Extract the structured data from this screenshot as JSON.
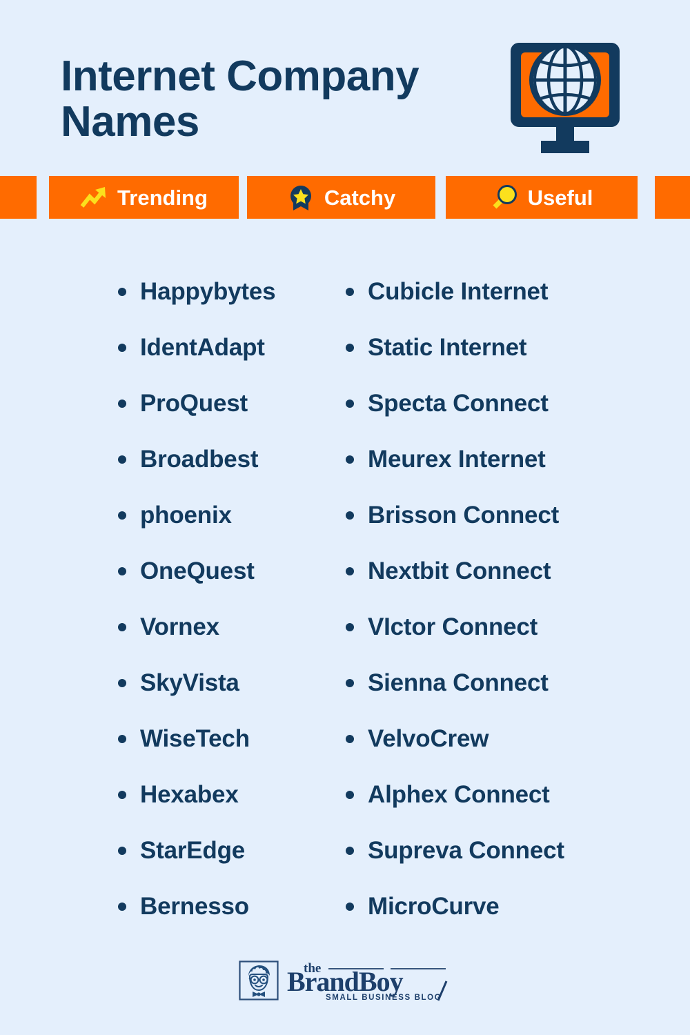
{
  "page": {
    "background_color": "#e4effc",
    "accent_color": "#ff6b00",
    "text_color": "#123a5e",
    "highlight_color": "#fbe01d"
  },
  "header": {
    "title": "Internet Company Names",
    "icon": "monitor-globe-icon"
  },
  "badges": [
    {
      "label": "Trending",
      "icon": "trending-up-icon"
    },
    {
      "label": "Catchy",
      "icon": "award-star-icon"
    },
    {
      "label": "Useful",
      "icon": "magnifier-icon"
    }
  ],
  "lists": {
    "left": [
      "Happybytes",
      "IdentAdapt",
      "ProQuest",
      "Broadbest",
      "phoenix",
      "OneQuest",
      "Vornex",
      "SkyVista",
      "WiseTech",
      "Hexabex",
      "StarEdge",
      "Bernesso"
    ],
    "right": [
      "Cubicle Internet",
      "Static Internet",
      "Specta Connect",
      "Meurex Internet",
      "Brisson Connect",
      "Nextbit Connect",
      "VIctor Connect",
      "Sienna Connect",
      "VelvoCrew",
      "Alphex Connect",
      "Supreva Connect",
      "MicroCurve"
    ]
  },
  "footer": {
    "logo_the": "the",
    "logo_brand": "Brand",
    "logo_boy": "Boy",
    "logo_tagline": "SMALL BUSINESS BLOG",
    "logo_mark": "boy-face-icon"
  }
}
